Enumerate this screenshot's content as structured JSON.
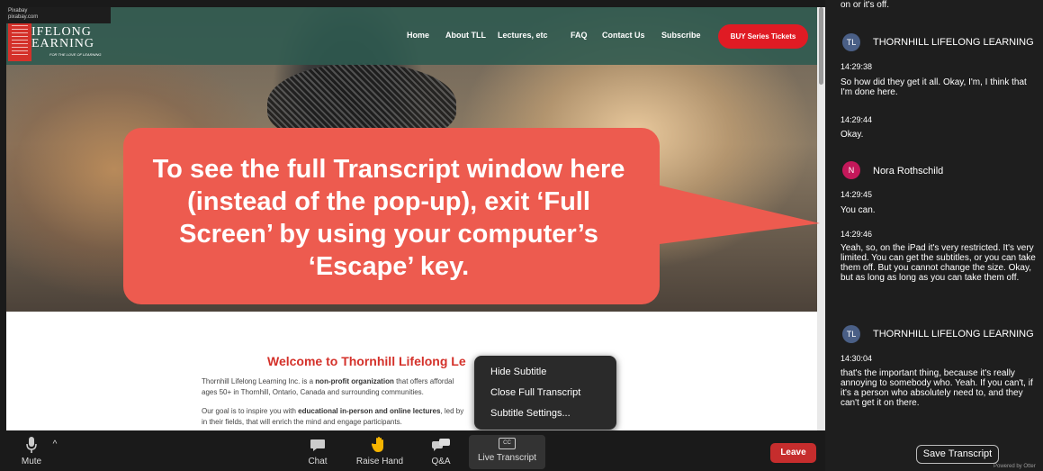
{
  "site": {
    "attribution": [
      "Pixabay",
      "pixabay.com"
    ],
    "logo": {
      "line1": "IFELONG",
      "line2": "EARNING",
      "tagline": "FOR THE LOVE OF LEARNING"
    },
    "nav": [
      "Home",
      "About TLL",
      "Lectures, etc",
      "FAQ",
      "Contact Us",
      "Subscribe"
    ],
    "buy_button": "BUY Series Tickets",
    "welcome": "Welcome to Thornhill Lifelong Le",
    "para1_a": "Thornhill Lifelong Learning Inc. is a ",
    "para1_b": "non-profit organization",
    "para1_c": " that offers affordal",
    "para1_d": "ages 50+ in Thornhill, Ontario, Canada and surrounding communities.",
    "para2_a": "Our goal is to inspire you with ",
    "para2_b": "educational in-person and online lectures",
    "para2_c": ", led by",
    "para2_d": "in their fields, that will enrich the mind and engage participants."
  },
  "callout": {
    "text": "To see the full Transcript window here (instead of the pop-up), exit ‘Full Screen’ by using your computer’s ‘Escape’ key.",
    "color": "#ed5b4f"
  },
  "popup_menu": [
    "Hide Subtitle",
    "Close Full Transcript",
    "Subtitle Settings..."
  ],
  "transcript": {
    "top_fragment": "on or it's off.",
    "entries": [
      {
        "speaker": "THORNHILL LIFELONG LEARNING",
        "initials": "TL",
        "avatar_color": "#4a5f86",
        "time1": "14:29:38",
        "msg1": "So how did they get it all. Okay, I'm, I think that I'm done here.",
        "time2": "14:29:44",
        "msg2": "Okay."
      },
      {
        "speaker": "Nora Rothschild",
        "initials": "N",
        "avatar_color": "#c4185a",
        "time1": "14:29:45",
        "msg1": "You can.",
        "time2": "14:29:46",
        "msg2": "Yeah, so, on the iPad it's very restricted. It's very limited. You can get the subtitles, or you can take them off. But you cannot change the size. Okay, but as long as long as you can take them off."
      },
      {
        "speaker": "THORNHILL LIFELONG LEARNING",
        "initials": "TL",
        "avatar_color": "#4a5f86",
        "time1": "14:30:04",
        "msg1": "that's the important thing, because it's really annoying to somebody who. Yeah. If you can't, if it's a person who absolutely need to, and they can't get it on there."
      }
    ],
    "save_button": "Save Transcript",
    "powered_by": "Powered by Otter"
  },
  "toolbar": {
    "mute": "Mute",
    "chat": "Chat",
    "raise_hand": "Raise Hand",
    "qa": "Q&A",
    "cc_badge": "CC",
    "live_transcript": "Live Transcript",
    "leave": "Leave"
  },
  "colors": {
    "leave": "#c62d2d",
    "buy": "#e01b24",
    "header": "#2d5a50"
  }
}
